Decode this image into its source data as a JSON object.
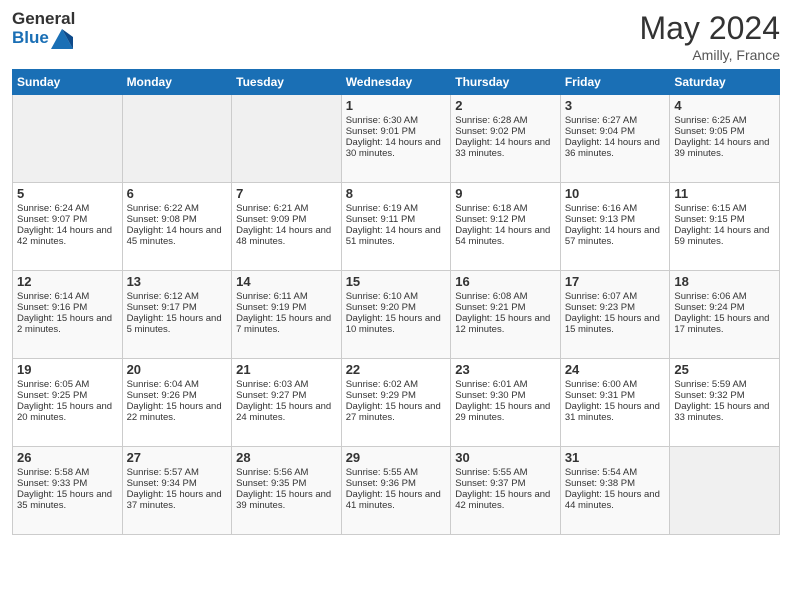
{
  "header": {
    "logo_general": "General",
    "logo_blue": "Blue",
    "month": "May 2024",
    "location": "Amilly, France"
  },
  "weekdays": [
    "Sunday",
    "Monday",
    "Tuesday",
    "Wednesday",
    "Thursday",
    "Friday",
    "Saturday"
  ],
  "weeks": [
    [
      {
        "day": "",
        "sunrise": "",
        "sunset": "",
        "daylight": ""
      },
      {
        "day": "",
        "sunrise": "",
        "sunset": "",
        "daylight": ""
      },
      {
        "day": "",
        "sunrise": "",
        "sunset": "",
        "daylight": ""
      },
      {
        "day": "1",
        "sunrise": "Sunrise: 6:30 AM",
        "sunset": "Sunset: 9:01 PM",
        "daylight": "Daylight: 14 hours and 30 minutes."
      },
      {
        "day": "2",
        "sunrise": "Sunrise: 6:28 AM",
        "sunset": "Sunset: 9:02 PM",
        "daylight": "Daylight: 14 hours and 33 minutes."
      },
      {
        "day": "3",
        "sunrise": "Sunrise: 6:27 AM",
        "sunset": "Sunset: 9:04 PM",
        "daylight": "Daylight: 14 hours and 36 minutes."
      },
      {
        "day": "4",
        "sunrise": "Sunrise: 6:25 AM",
        "sunset": "Sunset: 9:05 PM",
        "daylight": "Daylight: 14 hours and 39 minutes."
      }
    ],
    [
      {
        "day": "5",
        "sunrise": "Sunrise: 6:24 AM",
        "sunset": "Sunset: 9:07 PM",
        "daylight": "Daylight: 14 hours and 42 minutes."
      },
      {
        "day": "6",
        "sunrise": "Sunrise: 6:22 AM",
        "sunset": "Sunset: 9:08 PM",
        "daylight": "Daylight: 14 hours and 45 minutes."
      },
      {
        "day": "7",
        "sunrise": "Sunrise: 6:21 AM",
        "sunset": "Sunset: 9:09 PM",
        "daylight": "Daylight: 14 hours and 48 minutes."
      },
      {
        "day": "8",
        "sunrise": "Sunrise: 6:19 AM",
        "sunset": "Sunset: 9:11 PM",
        "daylight": "Daylight: 14 hours and 51 minutes."
      },
      {
        "day": "9",
        "sunrise": "Sunrise: 6:18 AM",
        "sunset": "Sunset: 9:12 PM",
        "daylight": "Daylight: 14 hours and 54 minutes."
      },
      {
        "day": "10",
        "sunrise": "Sunrise: 6:16 AM",
        "sunset": "Sunset: 9:13 PM",
        "daylight": "Daylight: 14 hours and 57 minutes."
      },
      {
        "day": "11",
        "sunrise": "Sunrise: 6:15 AM",
        "sunset": "Sunset: 9:15 PM",
        "daylight": "Daylight: 14 hours and 59 minutes."
      }
    ],
    [
      {
        "day": "12",
        "sunrise": "Sunrise: 6:14 AM",
        "sunset": "Sunset: 9:16 PM",
        "daylight": "Daylight: 15 hours and 2 minutes."
      },
      {
        "day": "13",
        "sunrise": "Sunrise: 6:12 AM",
        "sunset": "Sunset: 9:17 PM",
        "daylight": "Daylight: 15 hours and 5 minutes."
      },
      {
        "day": "14",
        "sunrise": "Sunrise: 6:11 AM",
        "sunset": "Sunset: 9:19 PM",
        "daylight": "Daylight: 15 hours and 7 minutes."
      },
      {
        "day": "15",
        "sunrise": "Sunrise: 6:10 AM",
        "sunset": "Sunset: 9:20 PM",
        "daylight": "Daylight: 15 hours and 10 minutes."
      },
      {
        "day": "16",
        "sunrise": "Sunrise: 6:08 AM",
        "sunset": "Sunset: 9:21 PM",
        "daylight": "Daylight: 15 hours and 12 minutes."
      },
      {
        "day": "17",
        "sunrise": "Sunrise: 6:07 AM",
        "sunset": "Sunset: 9:23 PM",
        "daylight": "Daylight: 15 hours and 15 minutes."
      },
      {
        "day": "18",
        "sunrise": "Sunrise: 6:06 AM",
        "sunset": "Sunset: 9:24 PM",
        "daylight": "Daylight: 15 hours and 17 minutes."
      }
    ],
    [
      {
        "day": "19",
        "sunrise": "Sunrise: 6:05 AM",
        "sunset": "Sunset: 9:25 PM",
        "daylight": "Daylight: 15 hours and 20 minutes."
      },
      {
        "day": "20",
        "sunrise": "Sunrise: 6:04 AM",
        "sunset": "Sunset: 9:26 PM",
        "daylight": "Daylight: 15 hours and 22 minutes."
      },
      {
        "day": "21",
        "sunrise": "Sunrise: 6:03 AM",
        "sunset": "Sunset: 9:27 PM",
        "daylight": "Daylight: 15 hours and 24 minutes."
      },
      {
        "day": "22",
        "sunrise": "Sunrise: 6:02 AM",
        "sunset": "Sunset: 9:29 PM",
        "daylight": "Daylight: 15 hours and 27 minutes."
      },
      {
        "day": "23",
        "sunrise": "Sunrise: 6:01 AM",
        "sunset": "Sunset: 9:30 PM",
        "daylight": "Daylight: 15 hours and 29 minutes."
      },
      {
        "day": "24",
        "sunrise": "Sunrise: 6:00 AM",
        "sunset": "Sunset: 9:31 PM",
        "daylight": "Daylight: 15 hours and 31 minutes."
      },
      {
        "day": "25",
        "sunrise": "Sunrise: 5:59 AM",
        "sunset": "Sunset: 9:32 PM",
        "daylight": "Daylight: 15 hours and 33 minutes."
      }
    ],
    [
      {
        "day": "26",
        "sunrise": "Sunrise: 5:58 AM",
        "sunset": "Sunset: 9:33 PM",
        "daylight": "Daylight: 15 hours and 35 minutes."
      },
      {
        "day": "27",
        "sunrise": "Sunrise: 5:57 AM",
        "sunset": "Sunset: 9:34 PM",
        "daylight": "Daylight: 15 hours and 37 minutes."
      },
      {
        "day": "28",
        "sunrise": "Sunrise: 5:56 AM",
        "sunset": "Sunset: 9:35 PM",
        "daylight": "Daylight: 15 hours and 39 minutes."
      },
      {
        "day": "29",
        "sunrise": "Sunrise: 5:55 AM",
        "sunset": "Sunset: 9:36 PM",
        "daylight": "Daylight: 15 hours and 41 minutes."
      },
      {
        "day": "30",
        "sunrise": "Sunrise: 5:55 AM",
        "sunset": "Sunset: 9:37 PM",
        "daylight": "Daylight: 15 hours and 42 minutes."
      },
      {
        "day": "31",
        "sunrise": "Sunrise: 5:54 AM",
        "sunset": "Sunset: 9:38 PM",
        "daylight": "Daylight: 15 hours and 44 minutes."
      },
      {
        "day": "",
        "sunrise": "",
        "sunset": "",
        "daylight": ""
      }
    ]
  ]
}
